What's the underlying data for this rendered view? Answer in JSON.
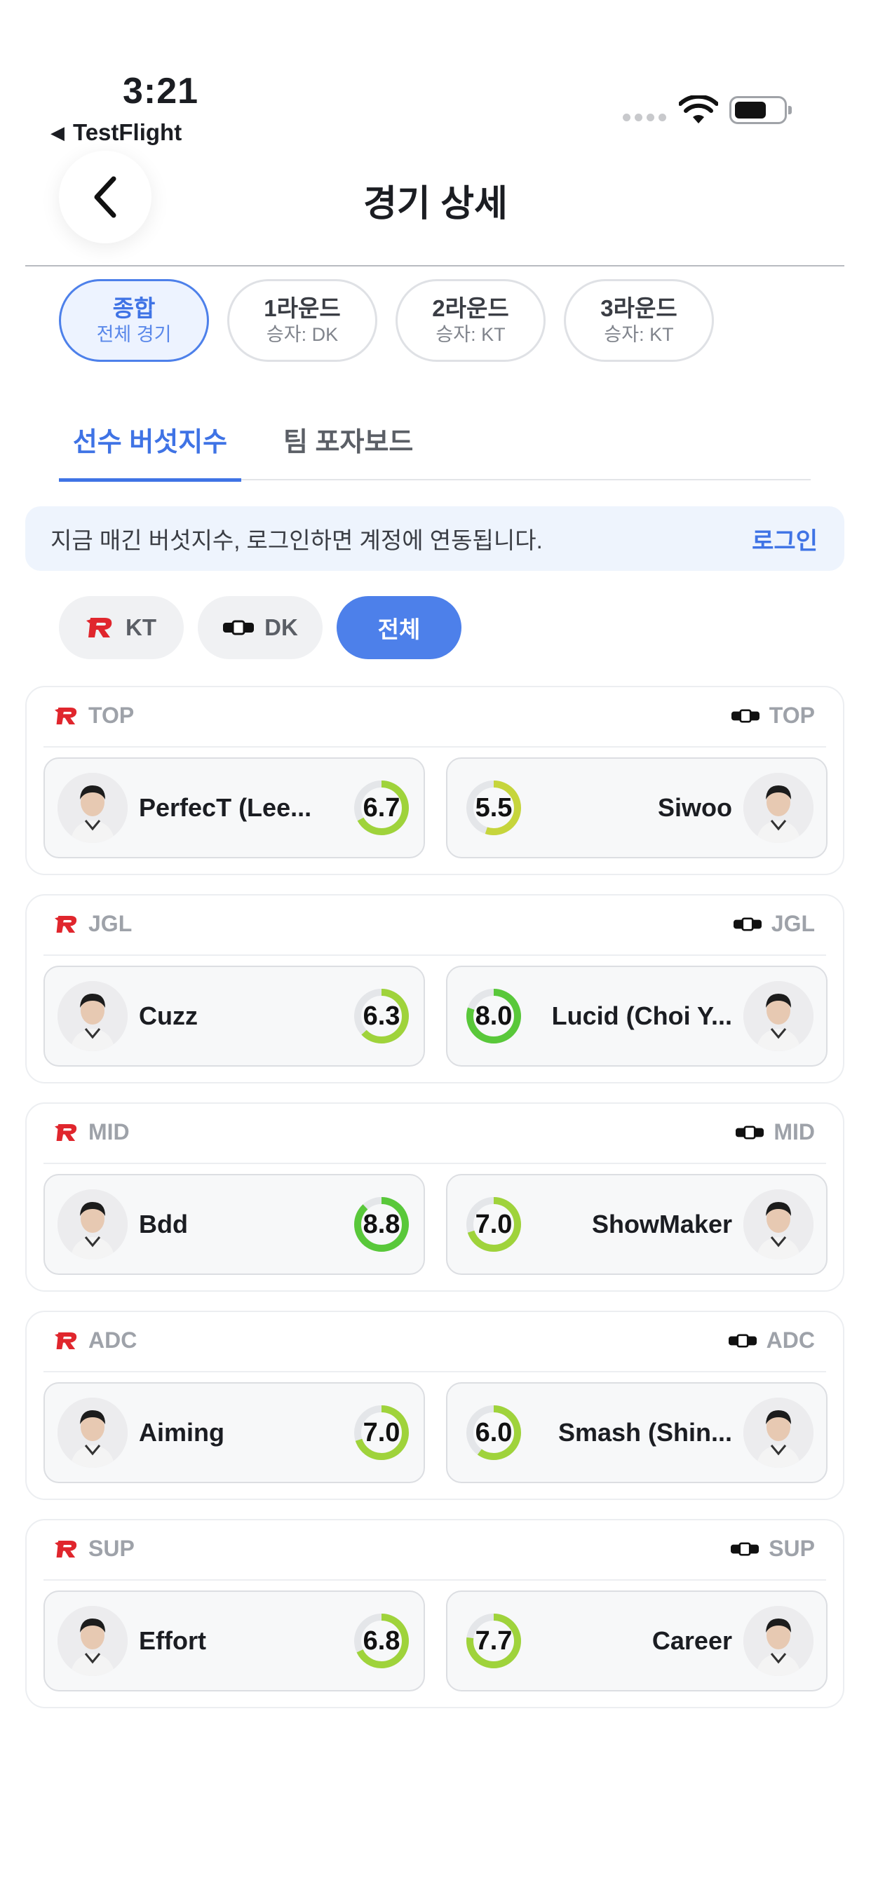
{
  "status": {
    "time": "3:21",
    "back_app": "TestFlight"
  },
  "header": {
    "title": "경기 상세"
  },
  "rounds": [
    {
      "title": "종합",
      "sub": "전체 경기",
      "active": true
    },
    {
      "title": "1라운드",
      "sub": "승자: DK",
      "active": false
    },
    {
      "title": "2라운드",
      "sub": "승자: KT",
      "active": false
    },
    {
      "title": "3라운드",
      "sub": "승자: KT",
      "active": false
    }
  ],
  "tabs": [
    {
      "label": "선수 버섯지수",
      "active": true
    },
    {
      "label": "팀 포자보드",
      "active": false
    }
  ],
  "notice": {
    "message": "지금 매긴 버섯지수, 로그인하면 계정에 연동됩니다.",
    "login": "로그인"
  },
  "filters": [
    {
      "label": "KT",
      "logo": "kt-logo"
    },
    {
      "label": "DK",
      "logo": "dk-logo"
    },
    {
      "label": "전체",
      "active": true
    }
  ],
  "colors": {
    "accent": "#4d80ea",
    "kt_red": "#e0262d",
    "score_green": "#59c83a",
    "score_lime": "#a8d33a",
    "score_yellow": "#c6d53c"
  },
  "positions": [
    {
      "pos": "TOP",
      "left": {
        "name": "PerfecT (Lee...",
        "score": "6.7",
        "fraction": 0.67
      },
      "right": {
        "name": "Siwoo",
        "score": "5.5",
        "fraction": 0.55
      }
    },
    {
      "pos": "JGL",
      "left": {
        "name": "Cuzz",
        "score": "6.3",
        "fraction": 0.63
      },
      "right": {
        "name": "Lucid (Choi Y...",
        "score": "8.0",
        "fraction": 0.8
      }
    },
    {
      "pos": "MID",
      "left": {
        "name": "Bdd",
        "score": "8.8",
        "fraction": 0.88
      },
      "right": {
        "name": "ShowMaker",
        "score": "7.0",
        "fraction": 0.7
      }
    },
    {
      "pos": "ADC",
      "left": {
        "name": "Aiming",
        "score": "7.0",
        "fraction": 0.7
      },
      "right": {
        "name": "Smash (Shin...",
        "score": "6.0",
        "fraction": 0.6
      }
    },
    {
      "pos": "SUP",
      "left": {
        "name": "Effort",
        "score": "6.8",
        "fraction": 0.68
      },
      "right": {
        "name": "Career",
        "score": "7.7",
        "fraction": 0.77
      }
    }
  ]
}
